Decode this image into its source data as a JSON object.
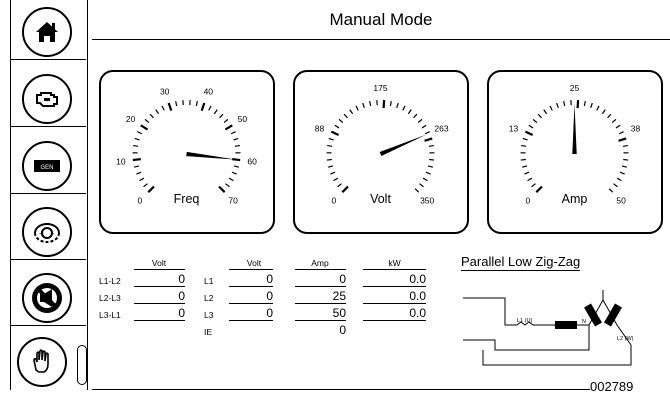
{
  "header": {
    "title": "Manual Mode"
  },
  "sidebar": {
    "items": [
      {
        "icon": "home-icon"
      },
      {
        "icon": "engine-icon"
      },
      {
        "icon": "generator-icon",
        "label": "GEN"
      },
      {
        "icon": "sync-icon"
      },
      {
        "icon": "no-horn-icon"
      },
      {
        "icon": "hand-icon"
      }
    ]
  },
  "gauges": [
    {
      "name": "Freq",
      "ticks": [
        "0",
        "10",
        "20",
        "30",
        "40",
        "50",
        "60",
        "70"
      ],
      "min": 0,
      "max": 70,
      "value": 60
    },
    {
      "name": "Volt",
      "ticks": [
        "0",
        "88",
        "175",
        "263",
        "350"
      ],
      "min": 0,
      "max": 350,
      "value": 262
    },
    {
      "name": "Amp",
      "ticks": [
        "0",
        "13",
        "25",
        "38",
        "50"
      ],
      "min": 0,
      "max": 50,
      "value": 25
    }
  ],
  "meter": {
    "headers": {
      "volt_ll": "Volt",
      "volt_ln": "Volt",
      "amp": "Amp",
      "kw": "kW"
    },
    "ll_rows": [
      {
        "label": "L1-L2",
        "value": "0"
      },
      {
        "label": "L2-L3",
        "value": "0"
      },
      {
        "label": "L3-L1",
        "value": "0"
      }
    ],
    "ln_rows": [
      {
        "label": "L1",
        "volt": "0",
        "amp": "0",
        "kw": "0.0"
      },
      {
        "label": "L2",
        "volt": "0",
        "amp": "25",
        "kw": "0.0"
      },
      {
        "label": "L3",
        "volt": "0",
        "amp": "50",
        "kw": "0.0"
      }
    ],
    "ie": {
      "label": "IE",
      "amp": "0"
    }
  },
  "diagram": {
    "title": "Parallel Low Zig-Zag",
    "labels": {
      "l1": "L1 (U)",
      "n": "N",
      "l2": "L2 (W)"
    }
  },
  "footer": {
    "code": "002789"
  }
}
